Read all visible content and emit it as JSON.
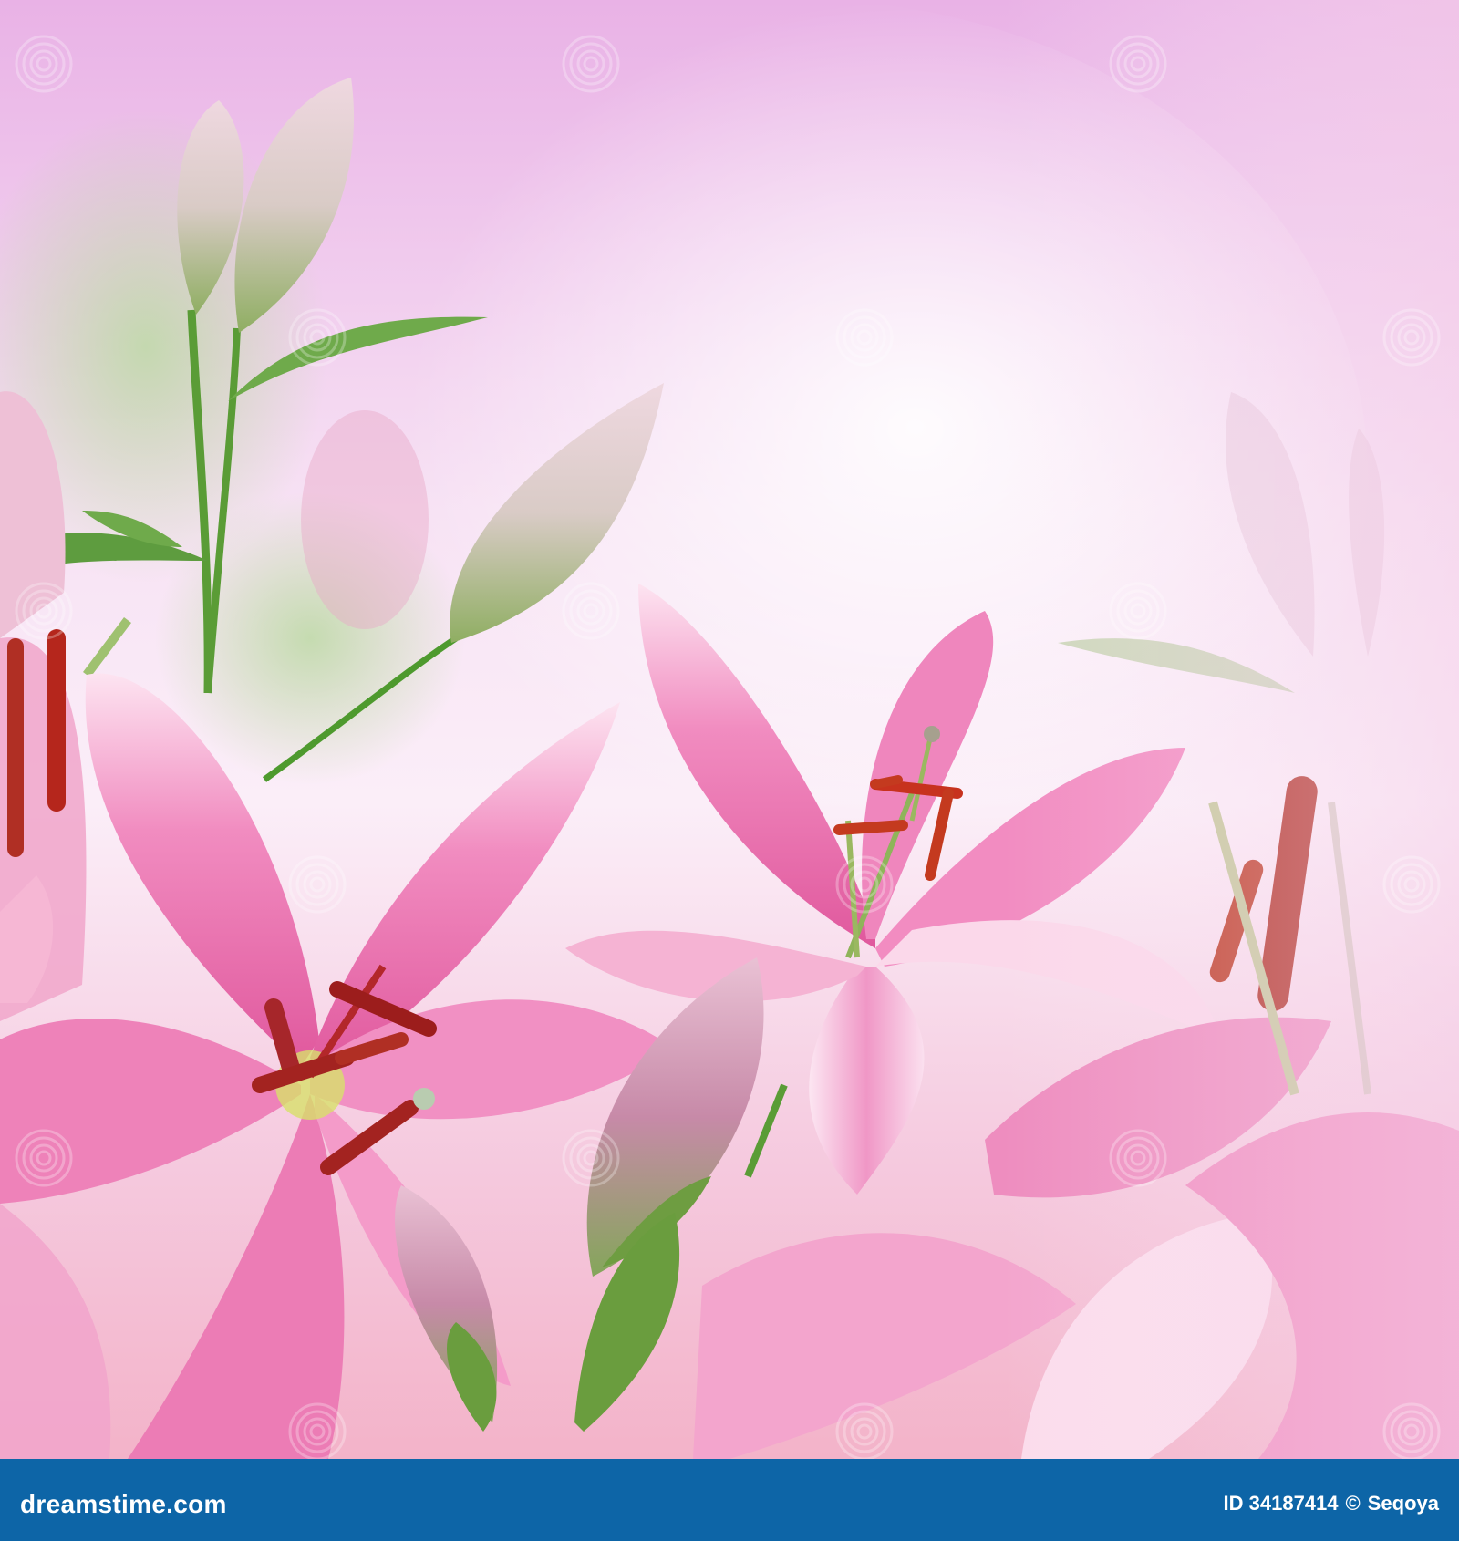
{
  "image": {
    "subject": "pink lilies",
    "colors": {
      "background_top": "#e9b2e6",
      "background_mid": "#fbeef8",
      "background_bottom": "#f3b3c9",
      "petal_pink": "#ef7fb8",
      "petal_edge": "#fde4f1",
      "stamen": "#b5261c",
      "stem_green": "#4e9a2e",
      "bud_green": "#a9bf85"
    },
    "watermark_icon": "spiral-logo-icon",
    "watermark_text": "dreamstime"
  },
  "footer": {
    "site": "dreamstime.com",
    "id_text": "ID 34187414",
    "copyright_symbol": "©",
    "author": "Seqoya",
    "bar_color": "#0d65a7"
  }
}
